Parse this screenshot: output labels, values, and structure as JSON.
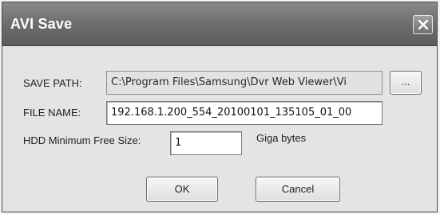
{
  "window": {
    "title": "AVI Save"
  },
  "save_path": {
    "label": "SAVE PATH:",
    "value": "C:\\Program Files\\Samsung\\Dvr Web Viewer\\Vi",
    "browse_label": "..."
  },
  "file_name": {
    "label": "FILE NAME:",
    "value": "192.168.1.200_554_20100101_135105_01_00"
  },
  "hdd": {
    "label": "HDD Minimum Free Size:",
    "value": "1",
    "unit": "Giga bytes"
  },
  "buttons": {
    "ok": "OK",
    "cancel": "Cancel"
  }
}
